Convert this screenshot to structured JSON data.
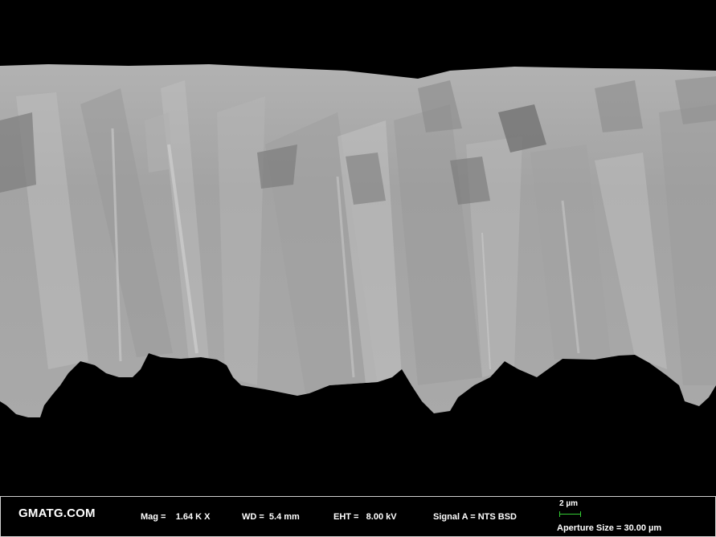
{
  "micrograph": {
    "subject": "cross-section of columnar grain coating",
    "colors": {
      "background": "#000000",
      "base_gray": "#a6a6a6",
      "light_gray": "#c4c4c4",
      "dark_gray": "#7e7e7e"
    }
  },
  "info_bar": {
    "brand": "GMATG.COM",
    "mag": "Mag =    1.64 K X",
    "wd": "WD =  5.4 mm",
    "eht": "EHT =   8.00 kV",
    "signal": "Signal A = NTS BSD",
    "scale_label": "2 µm",
    "aperture": "Aperture Size = 30.00 µm",
    "scale_color": "#33cc33"
  }
}
